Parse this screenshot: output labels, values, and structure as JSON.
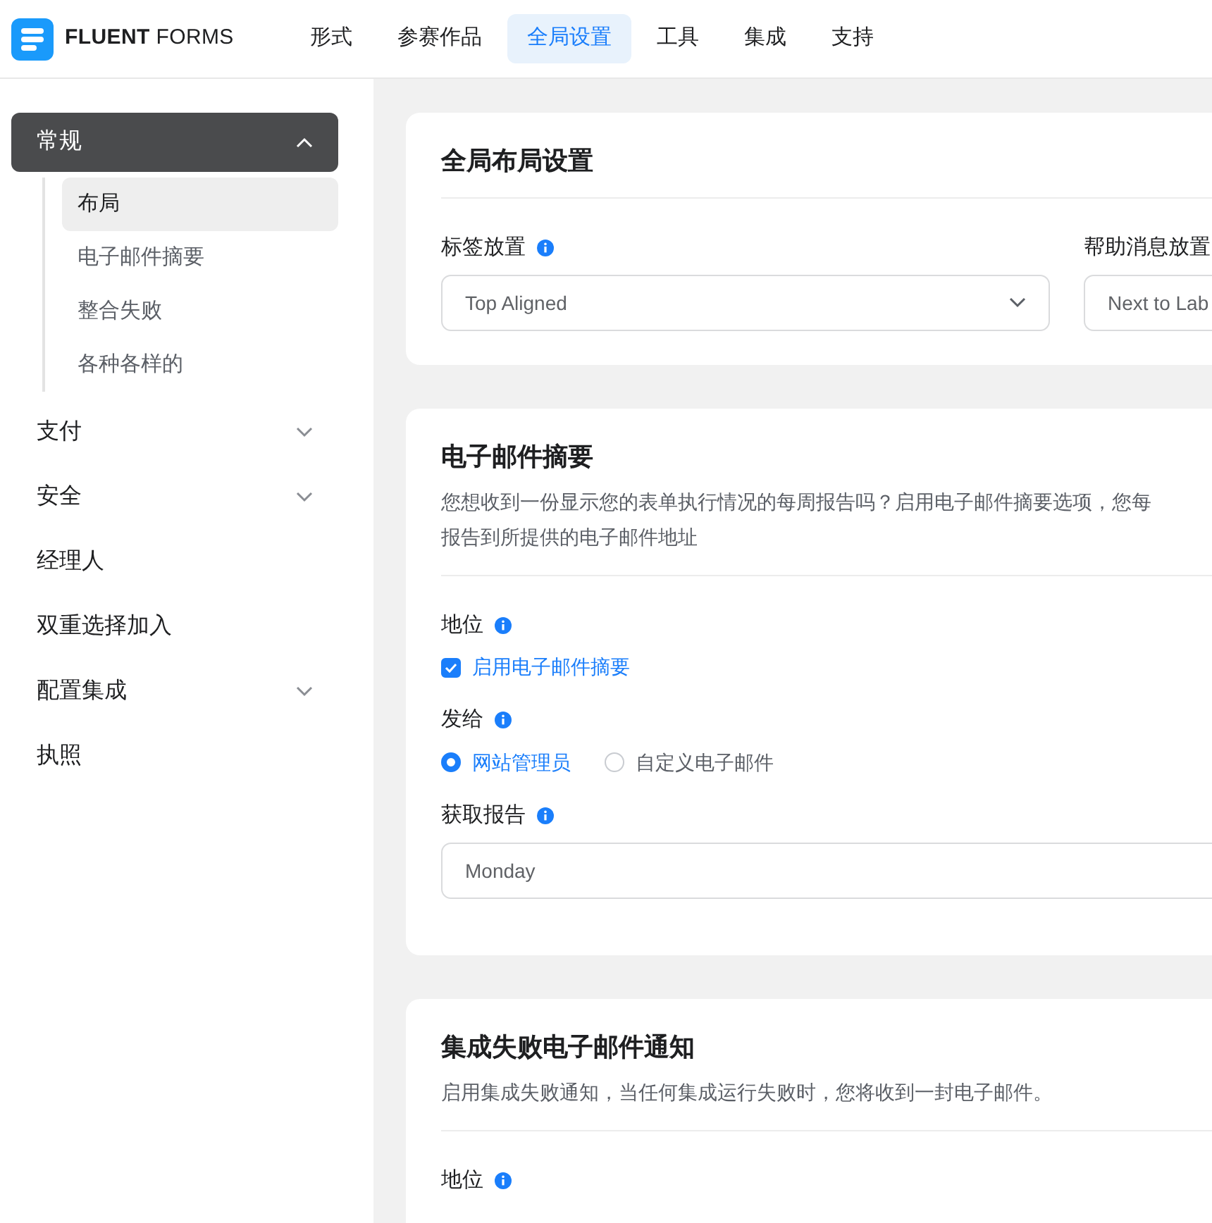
{
  "brand": {
    "bold": "FLUENT",
    "light": "FORMS"
  },
  "nav": [
    {
      "label": "形式",
      "selected": false
    },
    {
      "label": "参赛作品",
      "selected": false
    },
    {
      "label": "全局设置",
      "selected": true
    },
    {
      "label": "工具",
      "selected": false
    },
    {
      "label": "集成",
      "selected": false
    },
    {
      "label": "支持",
      "selected": false
    }
  ],
  "sidebar": [
    {
      "kind": "group",
      "label": "常规",
      "selected": true,
      "expanded": true,
      "children": [
        {
          "label": "布局",
          "selected": true
        },
        {
          "label": "电子邮件摘要",
          "selected": false
        },
        {
          "label": "整合失败",
          "selected": false
        },
        {
          "label": "各种各样的",
          "selected": false
        }
      ]
    },
    {
      "kind": "group",
      "label": "支付",
      "selected": false,
      "expanded": false
    },
    {
      "kind": "group",
      "label": "安全",
      "selected": false,
      "expanded": false
    },
    {
      "kind": "link",
      "label": "经理人",
      "selected": false
    },
    {
      "kind": "link",
      "label": "双重选择加入",
      "selected": false
    },
    {
      "kind": "group",
      "label": "配置集成",
      "selected": false,
      "expanded": false
    },
    {
      "kind": "link",
      "label": "执照",
      "selected": false
    }
  ],
  "cards": [
    {
      "title": "全局布局设置",
      "fields": [
        {
          "kind": "row",
          "fields": [
            {
              "kind": "select",
              "label": "标签放置",
              "info": true,
              "value": "Top Aligned"
            },
            {
              "kind": "select",
              "label": "帮助消息放置",
              "info": false,
              "value": "Next to Lab"
            }
          ]
        }
      ]
    },
    {
      "title": "电子邮件摘要",
      "description_lines": [
        "您想收到一份显示您的表单执行情况的每周报告吗？启用电子邮件摘要选项，您每",
        "报告到所提供的电子邮件地址"
      ],
      "fields": [
        {
          "kind": "checkbox",
          "label": "地位",
          "info": true,
          "option": "启用电子邮件摘要",
          "checked": true
        },
        {
          "kind": "radio",
          "label": "发给",
          "info": true,
          "options": [
            {
              "label": "网站管理员",
              "selected": true
            },
            {
              "label": "自定义电子邮件",
              "selected": false
            }
          ]
        },
        {
          "kind": "select",
          "label": "获取报告",
          "info": true,
          "value": "Monday"
        }
      ]
    },
    {
      "title": "集成失败电子邮件通知",
      "description_lines": [
        "启用集成失败通知，当任何集成运行失败时，您将收到一封电子邮件。"
      ],
      "fields": [
        {
          "kind": "label",
          "label": "地位",
          "info": true
        }
      ]
    }
  ]
}
